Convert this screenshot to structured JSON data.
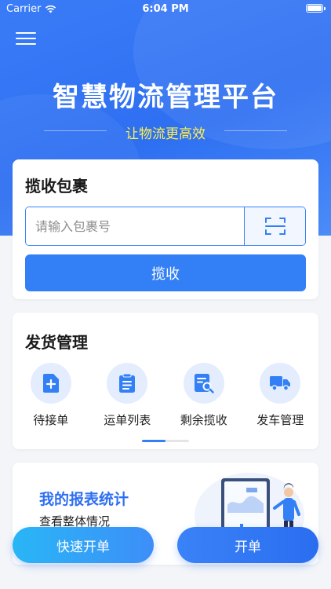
{
  "status_bar": {
    "carrier": "Carrier",
    "time": "6:04 PM"
  },
  "header": {
    "title": "智慧物流管理平台",
    "subtitle": "让物流更高效"
  },
  "pickup": {
    "title": "揽收包裹",
    "input_placeholder": "请输入包裹号",
    "submit_label": "揽收",
    "scan_icon": "scan-icon"
  },
  "shipping": {
    "title": "发货管理",
    "items": [
      {
        "label": "待接单",
        "icon": "add-document-icon"
      },
      {
        "label": "运单列表",
        "icon": "list-document-icon"
      },
      {
        "label": "剩余揽收",
        "icon": "search-document-icon"
      },
      {
        "label": "发车管理",
        "icon": "truck-icon"
      }
    ]
  },
  "report": {
    "title": "我的报表统计",
    "subtitle": "查看整体情况"
  },
  "bottom_actions": {
    "quick_order": "快速开单",
    "order": "开单"
  },
  "colors": {
    "primary": "#3380f6",
    "accent_yellow": "#fff14d",
    "icon_bg": "#e4edfd"
  }
}
